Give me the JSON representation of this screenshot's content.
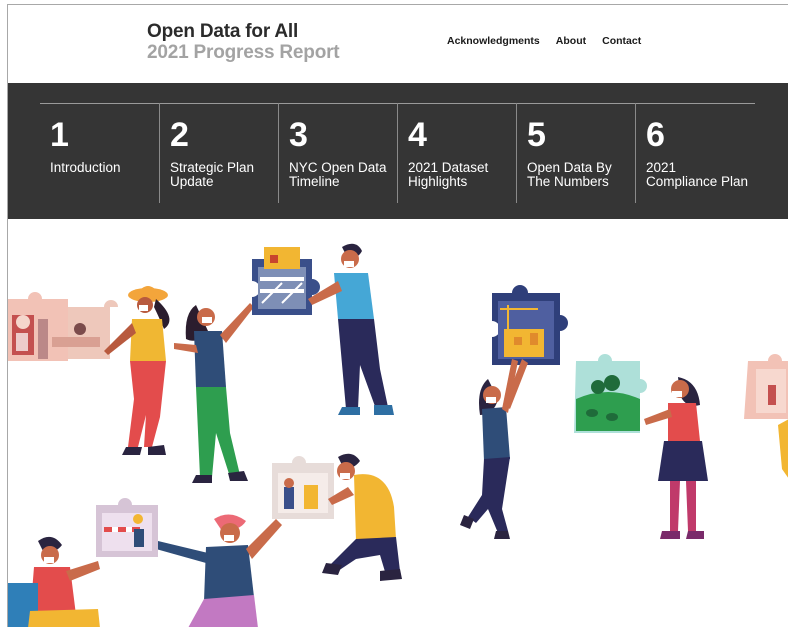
{
  "header": {
    "title": "Open Data for All",
    "subtitle": "2021 Progress Report",
    "nav": [
      "Acknowledgments",
      "About",
      "Contact"
    ]
  },
  "sections": [
    {
      "number": "1",
      "label": "Introduction"
    },
    {
      "number": "2",
      "label": "Strategic Plan Update"
    },
    {
      "number": "3",
      "label": "NYC Open Data Timeline"
    },
    {
      "number": "4",
      "label": "2021 Dataset Highlights"
    },
    {
      "number": "5",
      "label": "Open Data By The Numbers"
    },
    {
      "number": "6",
      "label": "2021 Compliance Plan"
    }
  ],
  "illustration": {
    "icon": "people-puzzle-illustration"
  },
  "colors": {
    "band": "#353535",
    "title": "#2b2b2b",
    "subtitle": "#a3a3a3"
  }
}
